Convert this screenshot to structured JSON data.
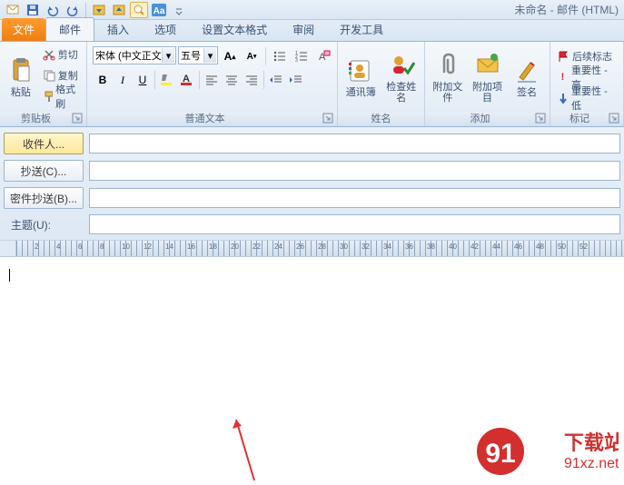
{
  "window_title": "未命名 - 邮件 (HTML)",
  "tabs": {
    "file": "文件",
    "mail": "邮件",
    "insert": "插入",
    "options": "选项",
    "format": "设置文本格式",
    "review": "审阅",
    "dev": "开发工具"
  },
  "clipboard": {
    "paste": "粘贴",
    "cut": "剪切",
    "copy": "复制",
    "painter": "格式刷",
    "group": "剪贴板"
  },
  "font": {
    "name": "宋体 (中文正文",
    "size": "五号",
    "group": "普通文本"
  },
  "names": {
    "addrbook": "通讯簿",
    "checknames": "检查姓名",
    "group": "姓名"
  },
  "include": {
    "attachfile": "附加文件",
    "attachitem": "附加项目",
    "signature": "签名",
    "group": "添加"
  },
  "tags": {
    "followup": "后续标志",
    "importance_hi": "重要性 - 高",
    "importance_lo": "重要性 - 低",
    "group": "标记"
  },
  "fields": {
    "to": "收件人...",
    "cc": "抄送(C)...",
    "bcc": "密件抄送(B)...",
    "subject": "主题(U):"
  },
  "watermark": {
    "line1": "下载站",
    "line2": "91xz.net"
  }
}
